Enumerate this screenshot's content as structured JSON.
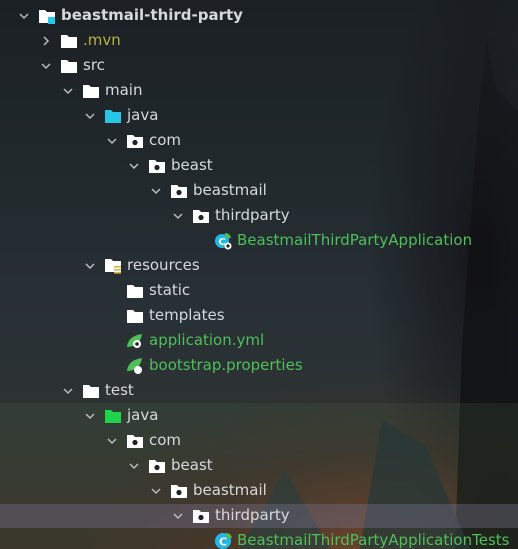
{
  "tree": {
    "nodes": [
      {
        "label": "beastmail-third-party",
        "depth": 0,
        "expanded": true,
        "icon": "module-folder-icon",
        "bold": true
      },
      {
        "label": ".mvn",
        "depth": 1,
        "expanded": false,
        "icon": "folder-icon",
        "style": "excluded"
      },
      {
        "label": "src",
        "depth": 1,
        "expanded": true,
        "icon": "folder-icon"
      },
      {
        "label": "main",
        "depth": 2,
        "expanded": true,
        "icon": "folder-icon"
      },
      {
        "label": "java",
        "depth": 3,
        "expanded": true,
        "icon": "source-root-folder-icon",
        "iconColor": "#25c6e6"
      },
      {
        "label": "com",
        "depth": 4,
        "expanded": true,
        "icon": "package-icon"
      },
      {
        "label": "beast",
        "depth": 5,
        "expanded": true,
        "icon": "package-icon"
      },
      {
        "label": "beastmail",
        "depth": 6,
        "expanded": true,
        "icon": "package-icon"
      },
      {
        "label": "thirdparty",
        "depth": 7,
        "expanded": true,
        "icon": "package-icon"
      },
      {
        "label": "BeastmailThirdPartyApplication",
        "depth": 8,
        "leaf": true,
        "icon": "spring-boot-class-icon",
        "style": "green"
      },
      {
        "label": "resources",
        "depth": 3,
        "expanded": true,
        "icon": "resources-folder-icon"
      },
      {
        "label": "static",
        "depth": 4,
        "leaf": true,
        "icon": "folder-icon"
      },
      {
        "label": "templates",
        "depth": 4,
        "leaf": true,
        "icon": "folder-icon"
      },
      {
        "label": "application.yml",
        "depth": 4,
        "leaf": true,
        "icon": "spring-config-icon",
        "style": "green"
      },
      {
        "label": "bootstrap.properties",
        "depth": 4,
        "leaf": true,
        "icon": "spring-properties-icon",
        "style": "green"
      },
      {
        "label": "test",
        "depth": 2,
        "expanded": true,
        "icon": "folder-icon"
      },
      {
        "label": "java",
        "depth": 3,
        "expanded": true,
        "icon": "test-root-folder-icon",
        "iconColor": "#1fd44a"
      },
      {
        "label": "com",
        "depth": 4,
        "expanded": true,
        "icon": "package-icon"
      },
      {
        "label": "beast",
        "depth": 5,
        "expanded": true,
        "icon": "package-icon"
      },
      {
        "label": "beastmail",
        "depth": 6,
        "expanded": true,
        "icon": "package-icon"
      },
      {
        "label": "thirdparty",
        "depth": 7,
        "expanded": true,
        "icon": "package-icon",
        "selected": true
      },
      {
        "label": "BeastmailThirdPartyApplicationTests",
        "depth": 8,
        "leaf": true,
        "icon": "test-class-icon",
        "style": "green"
      }
    ]
  },
  "colors": {
    "text": "#d6d9dc",
    "excluded": "#b8b23d",
    "vcs_added": "#4fbf5a",
    "source_root": "#25c6e6",
    "test_root": "#1fd44a",
    "folder": "#ffffff",
    "class_badge": "#23b7e5"
  }
}
